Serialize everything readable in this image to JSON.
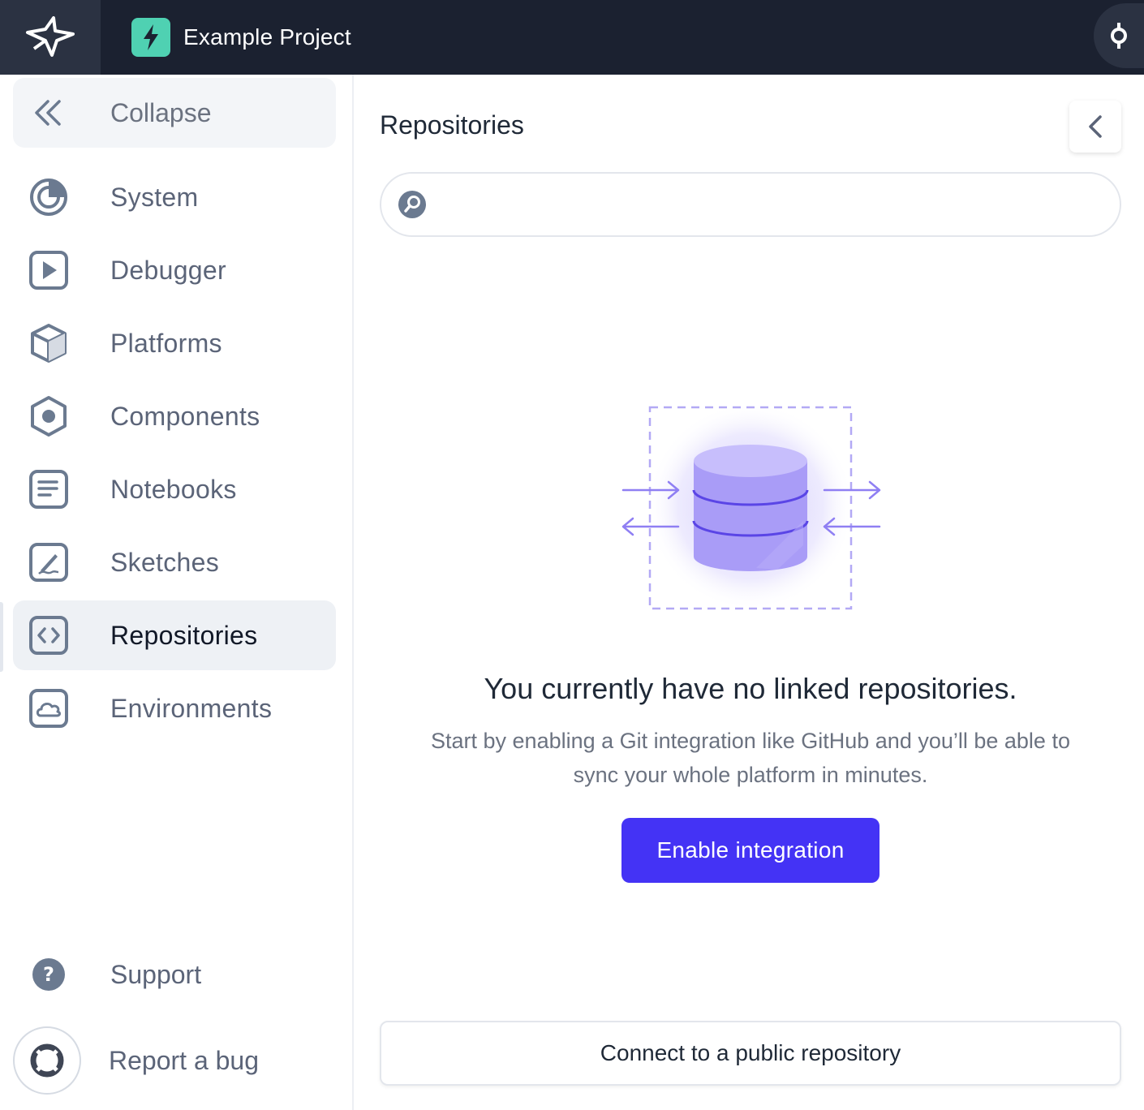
{
  "header": {
    "project_name": "Example Project"
  },
  "sidebar": {
    "collapse_label": "Collapse",
    "items": [
      {
        "label": "System",
        "icon": "system-gauge-icon"
      },
      {
        "label": "Debugger",
        "icon": "play-icon"
      },
      {
        "label": "Platforms",
        "icon": "cube-icon"
      },
      {
        "label": "Components",
        "icon": "hexagon-icon"
      },
      {
        "label": "Notebooks",
        "icon": "notebook-icon"
      },
      {
        "label": "Sketches",
        "icon": "sketch-pen-icon"
      },
      {
        "label": "Repositories",
        "icon": "code-brackets-icon",
        "active": true
      },
      {
        "label": "Environments",
        "icon": "cloud-icon"
      }
    ],
    "support_label": "Support",
    "bug_label": "Report a bug"
  },
  "main": {
    "title": "Repositories",
    "search_placeholder": "",
    "empty_title": "You currently have no linked repositories.",
    "empty_desc_line1": "Start by enabling a Git integration like GitHub and you’ll be able to",
    "empty_desc_line2": "sync your whole platform in minutes.",
    "enable_button": "Enable integration",
    "connect_button": "Connect to a public repository"
  },
  "colors": {
    "topbar": "#1b2130",
    "accent_button": "#4433f5",
    "project_icon": "#4fd1b2",
    "illustration_purple": "#a99cf7"
  }
}
